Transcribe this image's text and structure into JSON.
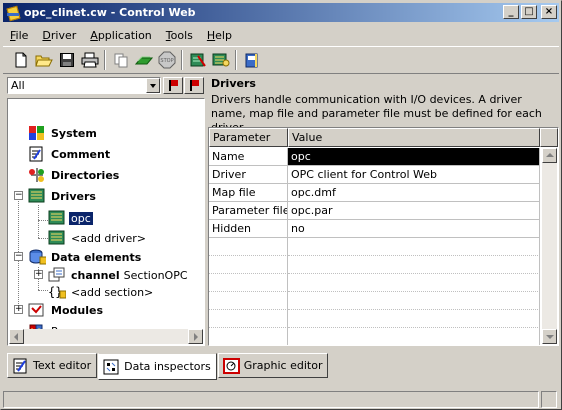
{
  "window": {
    "title": "opc_clinet.cw - Control Web"
  },
  "title_buttons": {
    "minimize": "_",
    "maximize": "□",
    "close": "×"
  },
  "menu": [
    {
      "label": "File",
      "accel": "F",
      "rest": "ile"
    },
    {
      "label": "Driver",
      "accel": "D",
      "rest": "river"
    },
    {
      "label": "Application",
      "accel": "A",
      "rest": "pplication"
    },
    {
      "label": "Tools",
      "accel": "T",
      "rest": "ools"
    },
    {
      "label": "Help",
      "accel": "H",
      "rest": "elp"
    }
  ],
  "filter": {
    "value": "All"
  },
  "tree": {
    "system": "System",
    "comment": "Comment",
    "directories": "Directories",
    "drivers": "Drivers",
    "driver_opc": "opc",
    "add_driver": "<add driver>",
    "data_elements": "Data elements",
    "channel_keyword": "channel",
    "channel_name": "SectionOPC",
    "add_section": "<add section>",
    "modules": "Modules",
    "programs": "Programs"
  },
  "description": {
    "title": "Drivers",
    "text": "Drivers handle communication with I/O devices. A driver name, map file and parameter file must be defined for each driver."
  },
  "grid": {
    "headers": [
      "Parameter",
      "Value"
    ],
    "rows": [
      {
        "param": "Name",
        "value": "opc"
      },
      {
        "param": "Driver",
        "value": "OPC client for Control Web"
      },
      {
        "param": "Map file",
        "value": "opc.dmf"
      },
      {
        "param": "Parameter file",
        "value": "opc.par"
      },
      {
        "param": "Hidden",
        "value": "no"
      }
    ]
  },
  "tabs": [
    {
      "label": "Text editor"
    },
    {
      "label": "Data inspectors"
    },
    {
      "label": "Graphic editor"
    }
  ],
  "colors": {
    "titlebar_start": "#0a246a",
    "titlebar_end": "#a6caf0",
    "selection": "#0a246a"
  }
}
